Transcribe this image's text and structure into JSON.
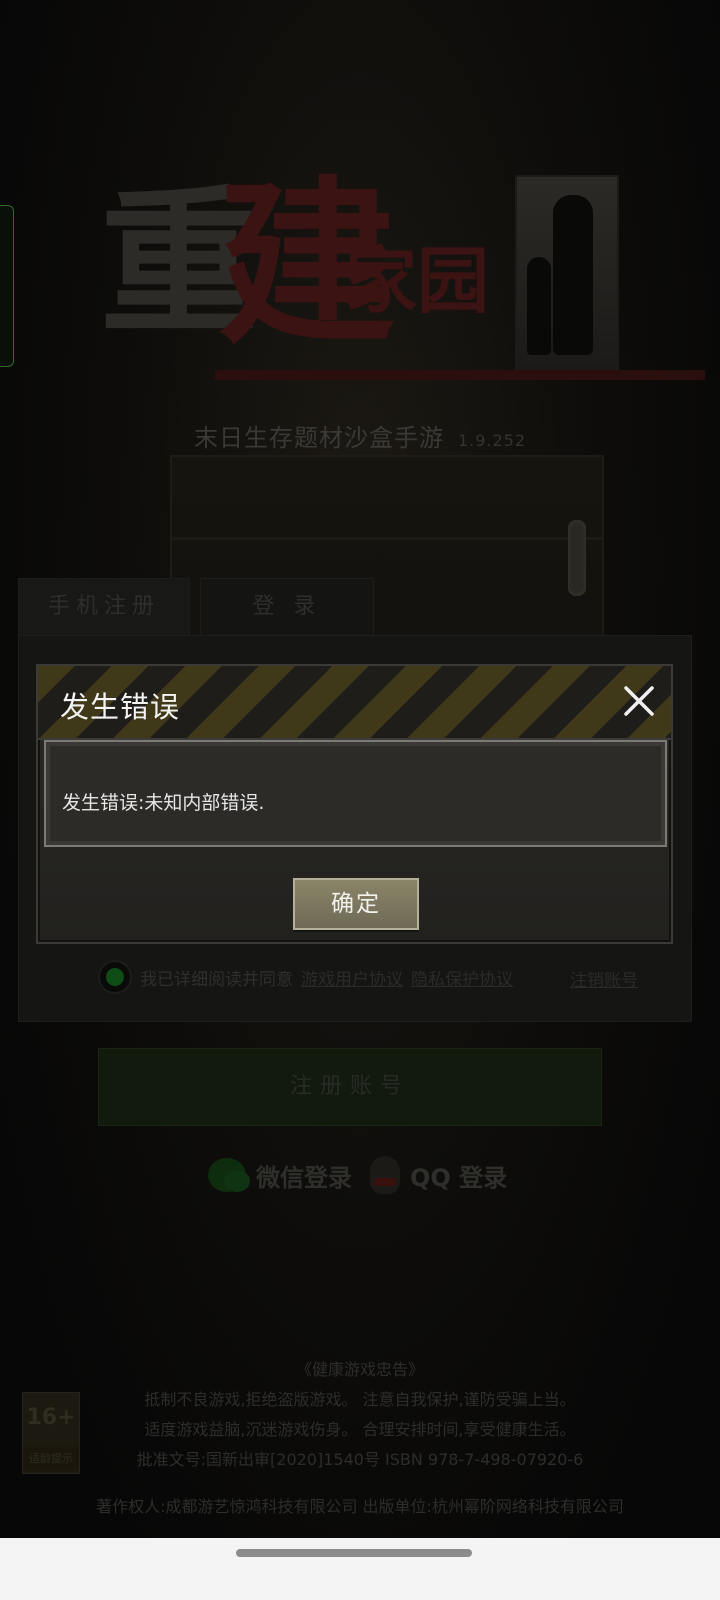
{
  "logo": {
    "title_char1": "重",
    "title_char2": "建",
    "title_small": "家园",
    "subtitle": "末日生存题材沙盒手游",
    "version": "1.9.252"
  },
  "login_panel": {
    "tabs": [
      {
        "label": "手机注册"
      },
      {
        "label": "登 录"
      }
    ],
    "agree_text": "我已详细阅读并同意",
    "user_agreement_link": "游戏用户协议",
    "privacy_link": "隐私保护协议",
    "cancel_account_link": "注销账号",
    "register_button": "注册账号",
    "wechat_login": "微信登录",
    "qq_login": "QQ 登录"
  },
  "footer": {
    "notice_title": "《健康游戏忠告》",
    "lines": [
      "抵制不良游戏,拒绝盗版游戏。 注意自我保护,谨防受骗上当。",
      "适度游戏益脑,沉迷游戏伤身。 合理安排时间,享受健康生活。",
      "批准文号:国新出审[2020]1540号   ISBN 978-7-498-07920-6"
    ],
    "credits": "著作权人:成都游艺惊鸿科技有限公司 出版单位:杭州幂阶网络科技有限公司",
    "age_badge_top": "16+",
    "age_badge_bottom": "适龄提示"
  },
  "dialog": {
    "title": "发生错误",
    "message": "发生错误:未知内部错误.",
    "confirm_button": "确定"
  },
  "colors": {
    "dialog_text": "#f3f3f3",
    "warning_stripe": "#3f3919",
    "confirm_button": "#8a8468"
  },
  "icons": {
    "close": "close-icon",
    "wechat": "wechat-icon",
    "qq": "qq-icon"
  }
}
